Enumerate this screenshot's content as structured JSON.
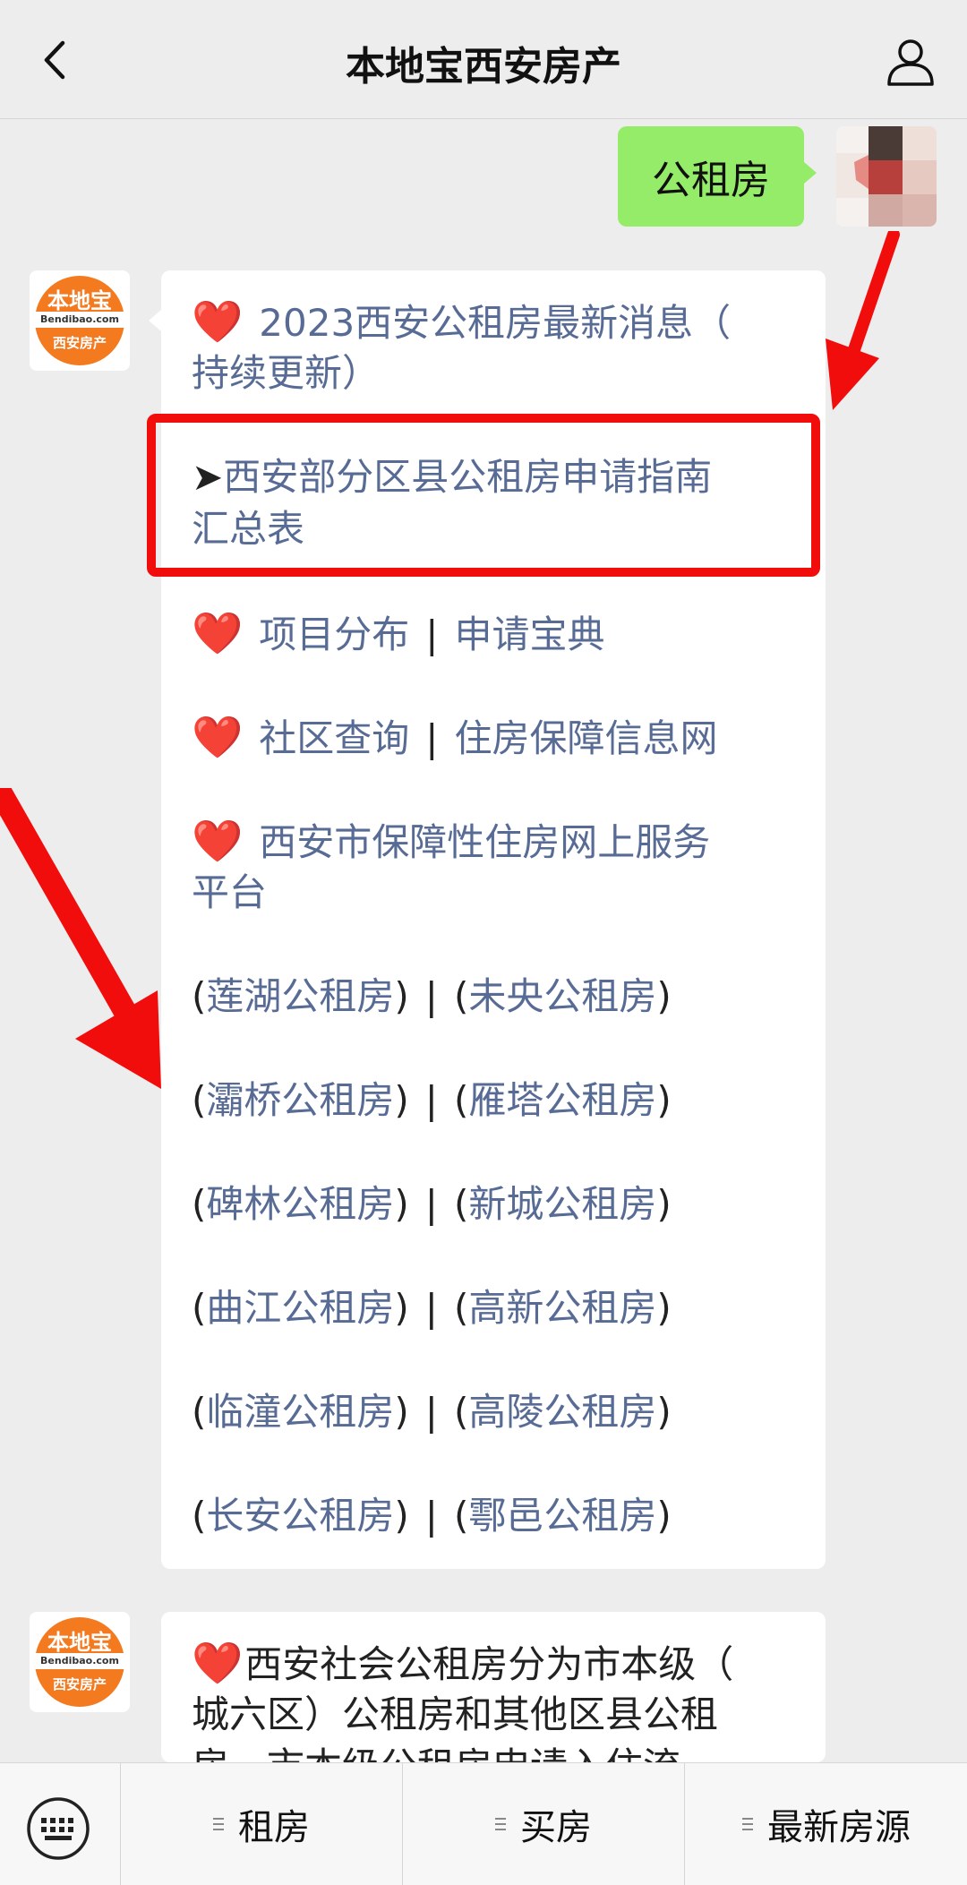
{
  "header": {
    "title": "本地宝西安房产"
  },
  "sent_message": {
    "text": "公租房"
  },
  "logo": {
    "brand": "本地宝",
    "site": "Bendibao.com",
    "sub": "西安房产"
  },
  "message1": {
    "heart": "❤️",
    "items": [
      {
        "text": "2023西安公租房最新消息（"
      },
      {
        "text": "持续更新）"
      }
    ],
    "guide": {
      "arrow": "➤",
      "line1": "西安部分区县公租房申请指南",
      "line2": "汇总表"
    },
    "row1": {
      "a": "项目分布",
      "sep": "|",
      "b": "申请宝典"
    },
    "row2": {
      "a": "社区查询",
      "sep": "|",
      "b": "住房保障信息网"
    },
    "row3": {
      "line1": "西安市保障性住房网上服务",
      "line2": "平台"
    },
    "districts": [
      {
        "a": "莲湖公租房",
        "b": "未央公租房"
      },
      {
        "a": "灞桥公租房",
        "b": "雁塔公租房"
      },
      {
        "a": "碑林公租房",
        "b": "新城公租房"
      },
      {
        "a": "曲江公租房",
        "b": "高新公租房"
      },
      {
        "a": "临潼公租房",
        "b": "高陵公租房"
      },
      {
        "a": "长安公租房",
        "b": "鄠邑公租房"
      }
    ],
    "open_paren": "(",
    "close_paren": ")",
    "pipe": "|"
  },
  "message2": {
    "line1": "西安社会公租房分为市本级（",
    "line2": "城六区）公租房和其他区县公租",
    "line3": "房，市本级公租房申请入住流"
  },
  "bottom_menu": {
    "items": [
      "租房",
      "买房",
      "最新房源"
    ]
  },
  "colors": {
    "link": "#576b95",
    "sent_bubble": "#95ec69",
    "highlight": "#f20d0d",
    "logo_orange": "#f47a20"
  }
}
